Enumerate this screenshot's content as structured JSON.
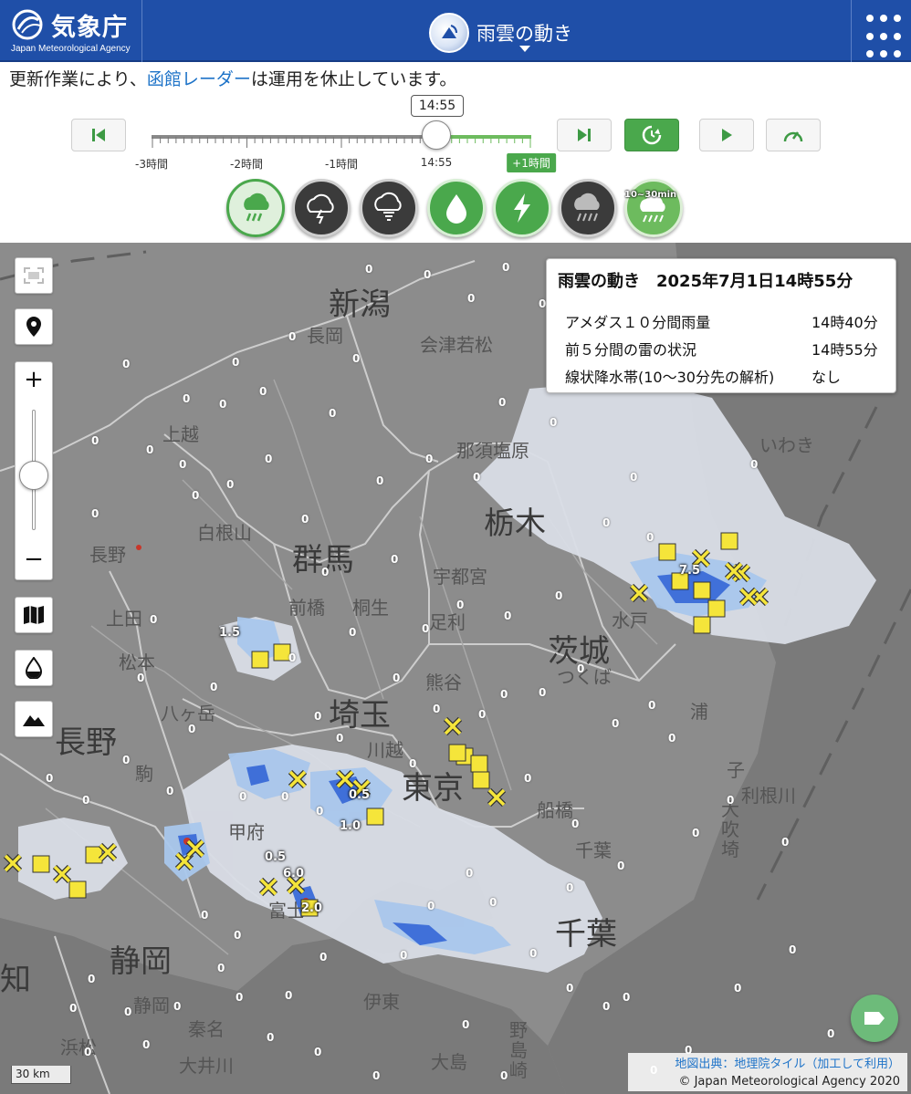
{
  "header": {
    "logo_text": "気象庁",
    "logo_sub": "Japan Meteorological Agency",
    "page_title": "雨雲の動き"
  },
  "notice": {
    "prefix": "更新作業により、",
    "link": "函館レーダー",
    "suffix": "は運用を休止しています。"
  },
  "timeline": {
    "current_time": "14:55",
    "ticks": [
      "-3時間",
      "-2時間",
      "-1時間",
      "14:55",
      "+1時間"
    ],
    "position_fraction": 0.75
  },
  "layers": [
    {
      "name": "rain-cloud",
      "state": "selected"
    },
    {
      "name": "thunder",
      "state": "off"
    },
    {
      "name": "tornado",
      "state": "off"
    },
    {
      "name": "rain-amount",
      "state": "on"
    },
    {
      "name": "lightning",
      "state": "on"
    },
    {
      "name": "linear-rainband",
      "state": "off"
    },
    {
      "name": "linear-rainband-forecast",
      "state": "on",
      "badge": "10~30min"
    }
  ],
  "info": {
    "title": "雨雲の動き　2025年7月1日14時55分",
    "rows": [
      {
        "label": "アメダス１０分間雨量",
        "value": "14時40分"
      },
      {
        "label": "前５分間の雷の状況",
        "value": "14時55分"
      },
      {
        "label": "線状降水帯(10〜30分先の解析)",
        "value": "なし"
      }
    ]
  },
  "map": {
    "prefectures": [
      "新潟",
      "群馬",
      "栃木",
      "茨城",
      "埼玉",
      "長野",
      "東京",
      "千葉",
      "静岡",
      "知"
    ],
    "cities": [
      "長岡",
      "会津若松",
      "上越",
      "那須塩原",
      "いわき",
      "長野",
      "白根山",
      "宇都宮",
      "前橋",
      "桐生",
      "上田",
      "松本",
      "足利",
      "水戸",
      "つくば",
      "熊谷",
      "川越",
      "八ヶ岳",
      "浦",
      "駒",
      "甲府",
      "利根川",
      "大吹埼",
      "船橋",
      "千葉",
      "富士",
      "伊東",
      "静岡",
      "大島",
      "野島崎",
      "浜松",
      "秦名",
      "大井川",
      "子"
    ],
    "rain_values": [
      "1.5",
      "7.5",
      "0.5",
      "1.0",
      "0.5",
      "6.0",
      "2.0"
    ],
    "scale": "30 km",
    "attribution_link": "地図出典：地理院タイル（加工して利用）",
    "copyright": "© Japan Meteorological Agency 2020"
  },
  "colors": {
    "header": "#1f4fa8",
    "accent_green": "#4aa84c",
    "link": "#1e73c8",
    "lightning_yellow": "#f5e53a"
  }
}
